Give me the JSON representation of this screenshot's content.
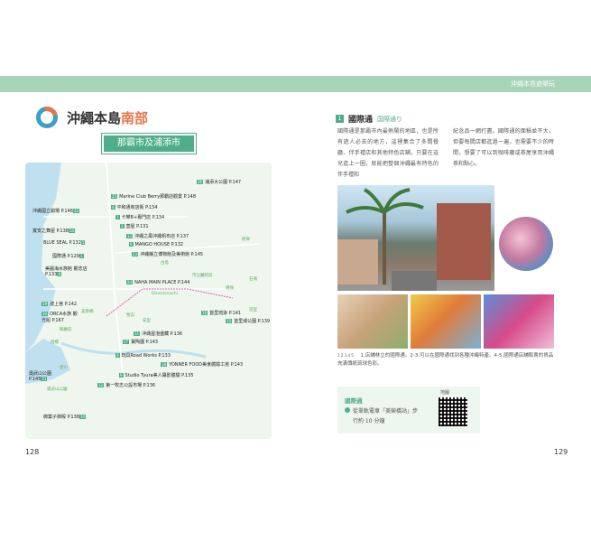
{
  "band": {
    "label": "沖繩本島遊樂玩"
  },
  "chapter": {
    "title_prefix": "沖繩本島",
    "title_accent": "南部"
  },
  "sub_banner": "那霸市及浦添市",
  "map": {
    "labels": [
      {
        "num": "",
        "text": "浦添大公園 P.147"
      },
      {
        "num": "",
        "text": "Marine Club Berry那霸店觀賞 P.148"
      },
      {
        "num": "",
        "text": "沖繩國立劇場 P.146"
      },
      {
        "num": "",
        "text": "平和通商店街 P.134"
      },
      {
        "num": "",
        "text": "卡樂B+專門店 P.134"
      },
      {
        "num": "",
        "text": "壺屋 P.131"
      },
      {
        "num": "",
        "text": "寬安之舞屋 P.138"
      },
      {
        "num": "",
        "text": "沖繩之風沖繩帆布店 P.137"
      },
      {
        "num": "",
        "text": "BLUE SEAL P.132"
      },
      {
        "num": "",
        "text": "MANGO HOUSE P.132"
      },
      {
        "num": "",
        "text": "國際通 P.129"
      },
      {
        "num": "",
        "text": "沖繩縣立博物館及美術館 P.145"
      },
      {
        "num": "",
        "text": "美麗海水族館 觀念店 P.133"
      },
      {
        "num": "",
        "text": "NAHA MAIN PLACE P.144"
      },
      {
        "num": "",
        "text": "波上宮 P.142"
      },
      {
        "num": "",
        "text": "首里琉染 P.141"
      },
      {
        "num": "",
        "text": "ORCA水族 觀光船 P.167"
      },
      {
        "num": "",
        "text": "首里城公園 P.139"
      },
      {
        "num": "",
        "text": "沖縄屋泡盛藏 P.136"
      },
      {
        "num": "",
        "text": "寶陶園 P.143"
      },
      {
        "num": "",
        "text": "玩具Road Works P.133"
      },
      {
        "num": "",
        "text": "YONNER FOOD美食體驗工房 P.143"
      },
      {
        "num": "",
        "text": "Studio Tyura美人攝影體驗 P.135"
      },
      {
        "num": "",
        "text": "奧武山公園 P.145"
      },
      {
        "num": "",
        "text": "第一牧志公設市場 P.136"
      },
      {
        "num": "",
        "text": "御菓子御殿 P.138"
      }
    ],
    "places": [
      "古島",
      "市立醫院前",
      "儀保",
      "首里",
      "石嶺",
      "經塚",
      "Omoromachi",
      "美榮橋",
      "牧志",
      "安里",
      "旭橋",
      "縣廳前",
      "壺川",
      "奧武山公園"
    ]
  },
  "pages": {
    "left": "128",
    "right": "129"
  },
  "section": {
    "num": "1",
    "title": "國際通",
    "jp": "国際通り",
    "col1": "國際通是那霸市內最熱鬧的地區，也是所有遊人必去的地方，這裡集合了多間餐廳、伴手禮店和其他特色店鋪，只要在這兒逛上一圈，就能把整個沖繩最有特色的伴手禮和",
    "col2": "紀念品一網打盡。國際通的面積並不大，但要每間店都逛過一遍，也需要不少的時間，想要了可以到咖啡廳或茶屋享用沖繩茶和點心。"
  },
  "caption": {
    "nums": "1 2 3 4 5",
    "text": "1.店舖林立的國際通。2-3.可以在國際通找到各種沖繩特產。4-5.國際通店舖販賣的貨品充滿傳統琉球色彩。"
  },
  "info": {
    "title": "國際通",
    "line1": "從單軌電車「美榮橋站」步",
    "line2": "行約 10 分鐘"
  },
  "qr_label": "地圖",
  "colors": {
    "accent": "#4fae8a",
    "orange": "#e8744a",
    "blue": "#3aa0c8"
  }
}
